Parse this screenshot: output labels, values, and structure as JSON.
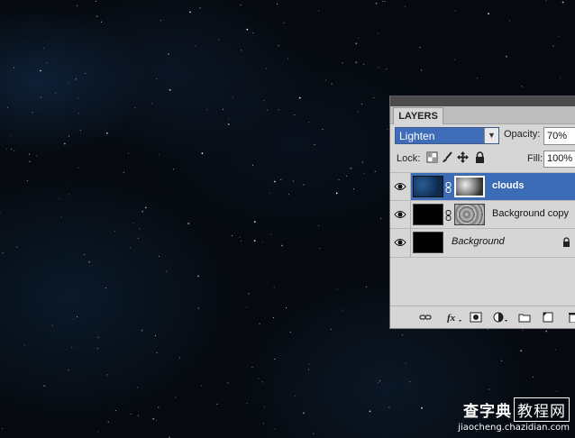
{
  "panel": {
    "tab_label": "LAYERS",
    "blend_mode": "Lighten",
    "opacity_label": "Opacity:",
    "opacity_value": "70%",
    "lock_label": "Lock:",
    "fill_label": "Fill:",
    "fill_value": "100%"
  },
  "layers": [
    {
      "name": "clouds",
      "selected": true,
      "visible": true
    },
    {
      "name": "Background copy",
      "selected": false,
      "visible": true
    },
    {
      "name": "Background",
      "selected": false,
      "visible": true,
      "locked": true
    }
  ],
  "watermark": {
    "main": "查字典",
    "boxed": "教程网",
    "sub": "jiaocheng.chazidian.com"
  },
  "colors": {
    "selection": "#3d6cb7",
    "panel_bg": "#d6d6d6",
    "canvas_bg": "#060a10"
  }
}
